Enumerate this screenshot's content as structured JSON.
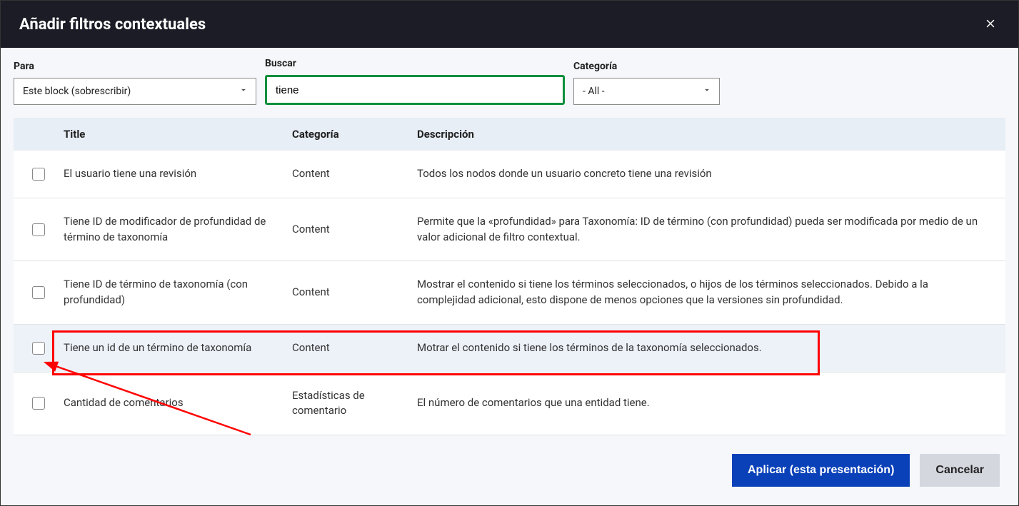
{
  "modal": {
    "title": "Añadir filtros contextuales"
  },
  "filters": {
    "para": {
      "label": "Para",
      "value": "Este block (sobrescribir)"
    },
    "buscar": {
      "label": "Buscar",
      "value": "tiene"
    },
    "categoria": {
      "label": "Categoría",
      "value": "- All -"
    }
  },
  "table": {
    "headers": {
      "title": "Title",
      "category": "Categoría",
      "description": "Descripción"
    },
    "rows": [
      {
        "title": "El usuario tiene una revisión",
        "category": "Content",
        "description": "Todos los nodos donde un usuario concreto tiene una revisión",
        "highlighted": false
      },
      {
        "title": "Tiene ID de modificador de profundidad de término de taxonomía",
        "category": "Content",
        "description": "Permite que la «profundidad» para Taxonomía: ID de término (con profundidad) pueda ser modificada por medio de un valor adicional de filtro contextual.",
        "highlighted": false
      },
      {
        "title": "Tiene ID de término de taxonomía (con profundidad)",
        "category": "Content",
        "description": "Mostrar el contenido si tiene los términos seleccionados, o hijos de los términos seleccionados. Debido a la complejidad adicional, esto dispone de menos opciones que la versiones sin profundidad.",
        "highlighted": false
      },
      {
        "title": "Tiene un id de un término de taxonomía",
        "category": "Content",
        "description": "Motrar el contenido si tiene los términos de la taxonomía seleccionados.",
        "highlighted": true
      },
      {
        "title": "Cantidad de comentarios",
        "category": "Estadísticas de comentario",
        "description": "El número de comentarios que una entidad tiene.",
        "highlighted": false
      }
    ]
  },
  "actions": {
    "apply": "Aplicar (esta presentación)",
    "cancel": "Cancelar"
  }
}
